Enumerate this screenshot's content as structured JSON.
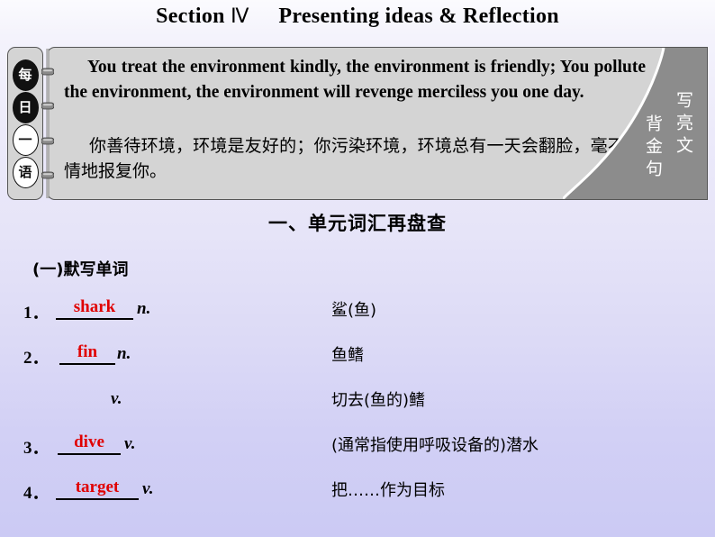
{
  "title": {
    "prefix": "Section",
    "numeral": "Ⅳ",
    "rest": "Presenting ideas & Reflection"
  },
  "note_box": {
    "tab_chars": [
      {
        "char": "每",
        "style": "dark"
      },
      {
        "char": "日",
        "style": "dark"
      },
      {
        "char": "一",
        "style": "light"
      },
      {
        "char": "语",
        "style": "light"
      }
    ],
    "side_label_right": "写亮文",
    "side_label_left": "背金句",
    "quote_en": "You treat the environment kindly, the environment is friendly; You pollute the environment, the environment will revenge merciless you one day.",
    "quote_zh": "你善待环境，环境是友好的；你污染环境，环境总有一天会翻脸，毫不留情地报复你。",
    "colors": {
      "panel": "#d4d4d4",
      "wedge": "#8c8c8c",
      "border": "#555555"
    }
  },
  "section_heading": "一、单元词汇再盘查",
  "sub_heading": "(一)默写单词",
  "vocab": {
    "word_color": "#e00000",
    "items": [
      {
        "num": "1．",
        "word": "shark",
        "pos": "n.",
        "definition": "鲨(鱼)"
      },
      {
        "num": "2．",
        "word": "fin",
        "pos": "n.",
        "definition": "鱼鳍"
      },
      {
        "num": "",
        "word": "",
        "pos": "v.",
        "definition": "切去(鱼的)鳍"
      },
      {
        "num": "3．",
        "word": "dive",
        "pos": "v.",
        "definition": "(通常指使用呼吸设备的)潜水"
      },
      {
        "num": "4．",
        "word": "target",
        "pos": "v.",
        "definition": "把……作为目标"
      }
    ]
  }
}
